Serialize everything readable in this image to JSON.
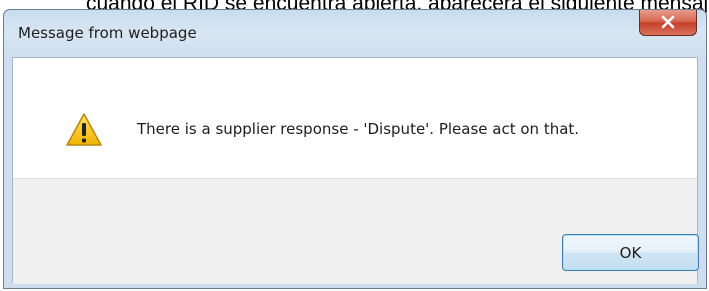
{
  "background": {
    "caption": "cuando el RID se encuentra abierta, aparecerá el siguiente mensaje"
  },
  "dialog": {
    "title": "Message from webpage",
    "message": "There is a supplier response - 'Dispute'. Please act on that.",
    "icon": "warning-icon",
    "close_icon": "close-icon",
    "ok_label": "OK"
  },
  "colors": {
    "titlebar": "#cfdeee",
    "close_button": "#c6402a",
    "footer": "#f0f0f0",
    "ok_border": "#3c7fb1",
    "warning_fill": "#f5c518"
  }
}
